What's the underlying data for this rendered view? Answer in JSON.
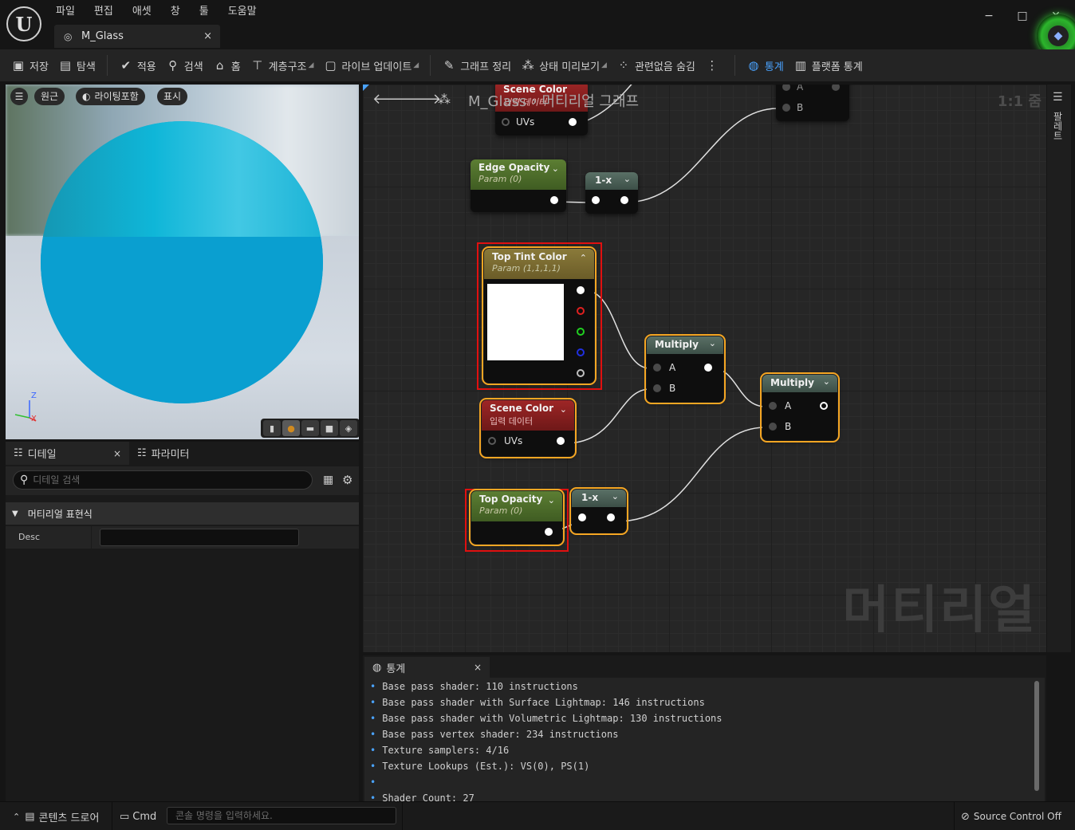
{
  "menu": [
    "파일",
    "편집",
    "애셋",
    "창",
    "툴",
    "도움말"
  ],
  "doc_tab": {
    "label": "M_Glass",
    "close": "×"
  },
  "window_controls": {
    "minimize": "−",
    "maximize": "□",
    "close": "✕"
  },
  "toolbar": {
    "save": "저장",
    "browse": "탐색",
    "apply": "적용",
    "search": "검색",
    "home": "홈",
    "hierarchy": "계층구조",
    "live_update": "라이브 업데이트",
    "clean_graph": "그래프 정리",
    "preview_state": "상태 미리보기",
    "hide_unrelated": "관련없음 숨김",
    "stats": "통계",
    "platform_stats": "플랫폼 통계"
  },
  "viewport": {
    "perspective": "원근",
    "lighting": "라이팅포함",
    "show": "표시",
    "axis_z": "Z",
    "axis_x": "X"
  },
  "details": {
    "tab_details": "디테일",
    "tab_params": "파라미터",
    "close": "×",
    "search_placeholder": "디테일 검색",
    "category": "머티리얼 표현식",
    "desc_label": "Desc"
  },
  "graph": {
    "title": "M_Glass",
    "breadcrumb_sep": "›",
    "subtitle": "머티리얼 그래프",
    "zoom": "1:1 줌",
    "watermark": "머티리얼",
    "nodes": {
      "scene_color_top": {
        "title": "Scene Color",
        "sub": "입력 데이터",
        "pin": "UVs"
      },
      "multiply_top": {
        "pin_a": "A",
        "pin_b": "B"
      },
      "edge_opacity": {
        "title": "Edge Opacity",
        "sub": "Param (0)"
      },
      "oneminus_top": {
        "title": "1-x"
      },
      "top_tint": {
        "title": "Top Tint Color",
        "sub": "Param (1,1,1,1)"
      },
      "scene_color": {
        "title": "Scene Color",
        "sub": "입력 데이터",
        "pin": "UVs"
      },
      "multiply_1": {
        "title": "Multiply",
        "pin_a": "A",
        "pin_b": "B"
      },
      "multiply_2": {
        "title": "Multiply",
        "pin_a": "A",
        "pin_b": "B"
      },
      "top_opacity": {
        "title": "Top Opacity",
        "sub": "Param (0)"
      },
      "oneminus_bottom": {
        "title": "1-x"
      }
    }
  },
  "palette": {
    "label": "팔레트"
  },
  "stats": {
    "tab": "통계",
    "close": "×",
    "lines": [
      "Base pass shader: 110 instructions",
      "Base pass shader with Surface Lightmap: 146 instructions",
      "Base pass shader with Volumetric Lightmap: 130 instructions",
      "Base pass vertex shader: 234 instructions",
      "Texture samplers: 4/16",
      "Texture Lookups (Est.): VS(0), PS(1)",
      "",
      "Shader Count: 27"
    ]
  },
  "statusbar": {
    "content_drawer": "콘텐츠 드로어",
    "cmd": "Cmd",
    "cmd_placeholder": "콘솔 명령을 입력하세요.",
    "source_control": "Source Control Off"
  }
}
